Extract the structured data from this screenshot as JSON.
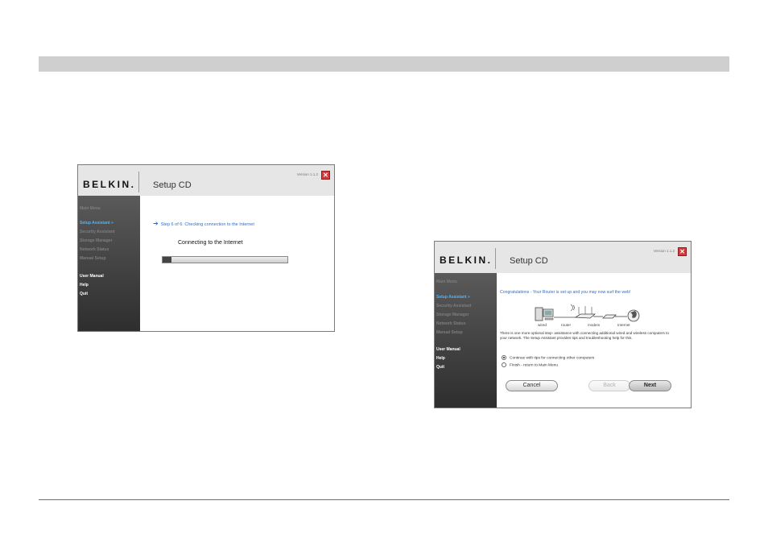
{
  "shot1": {
    "logo": "BELKIN.",
    "title": "Setup CD",
    "version": "Version 1.1.2",
    "nav": [
      {
        "label": "Main Menu"
      },
      {
        "label": "Setup Assistant »"
      },
      {
        "label": "Security Assistant"
      },
      {
        "label": "Storage Manager"
      },
      {
        "label": "Network Status"
      },
      {
        "label": "Manual Setup"
      },
      {
        "label": "User Manual"
      },
      {
        "label": "Help"
      },
      {
        "label": "Quit"
      }
    ],
    "step_text": "Step 6 of 6: Checking connection to the Internet",
    "connecting_label": "Connecting to the Internet",
    "progress": 0.07
  },
  "shot2": {
    "logo": "BELKIN.",
    "title": "Setup CD",
    "version": "Version 1.1.2",
    "nav": [
      {
        "label": "Main Menu"
      },
      {
        "label": "Setup Assistant »"
      },
      {
        "label": "Security Assistant"
      },
      {
        "label": "Storage Manager"
      },
      {
        "label": "Network Status"
      },
      {
        "label": "Manual Setup"
      },
      {
        "label": "User Manual"
      },
      {
        "label": "Help"
      },
      {
        "label": "Quit"
      }
    ],
    "congrats": "Congratulations - Your Router is set up and you may now surf the web!",
    "diagram_labels": {
      "wired": "wired",
      "router": "router",
      "modem": "modem",
      "internet": "Internet"
    },
    "paragraph": "There is one more optional step- assistance with connecting additional wired and wireless computers to your network. The Setup Assistant provides tips and troubleshooting help for this.",
    "options": [
      {
        "label": "Continue with tips for connecting other computers",
        "selected": true
      },
      {
        "label": "Finish - return to Main Menu",
        "selected": false
      }
    ],
    "buttons": {
      "cancel": "Cancel",
      "back": "Back",
      "next": "Next"
    }
  }
}
